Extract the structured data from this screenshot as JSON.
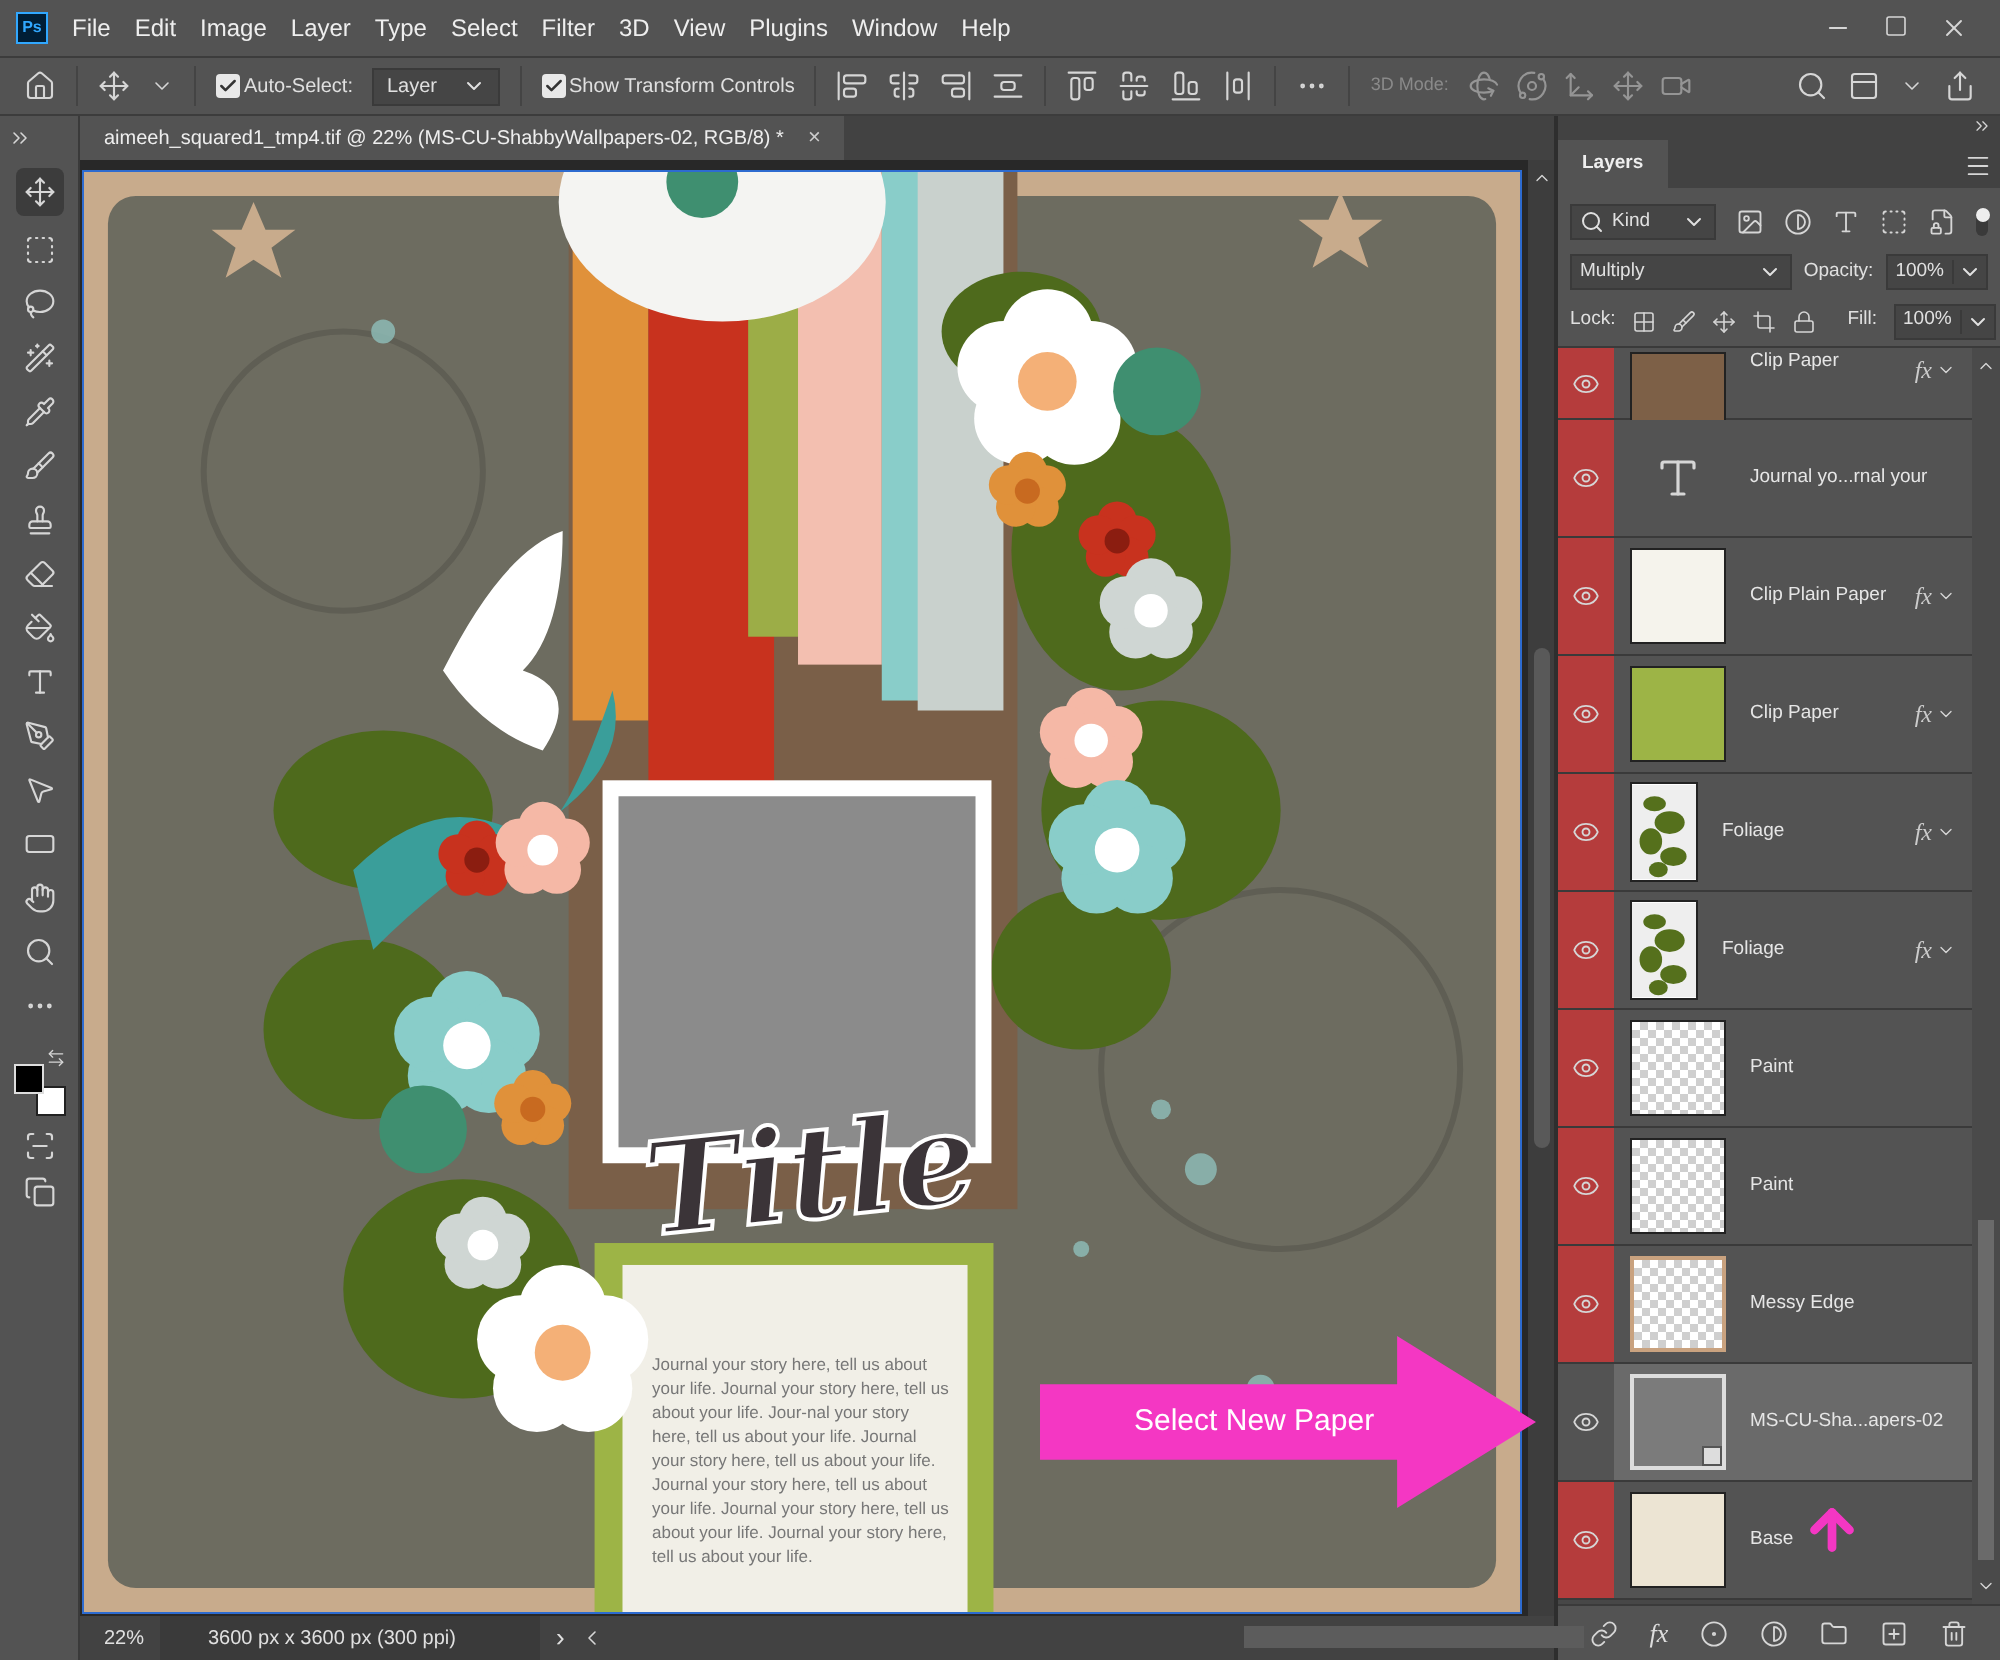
{
  "app_icon": "Ps",
  "menu": [
    "File",
    "Edit",
    "Image",
    "Layer",
    "Type",
    "Select",
    "Filter",
    "3D",
    "View",
    "Plugins",
    "Window",
    "Help"
  ],
  "options_bar": {
    "auto_select": {
      "label": "Auto-Select:",
      "checked": true
    },
    "target": "Layer",
    "show_transform": {
      "label": "Show Transform Controls",
      "checked": true
    },
    "mode_label": "3D Mode:"
  },
  "document_tab": {
    "title": "aimeeh_squared1_tmp4.tif @ 22% (MS-CU-ShabbyWallpapers-02, RGB/8) *",
    "close": "×"
  },
  "canvas": {
    "title": "Title",
    "journal": "Journal your story here, tell us about your life. Journal your story here, tell us about your life. Jour-nal your story here, tell us about your life. Journal your story here, tell us about your life. Journal your story here, tell us about your life. Journal your story here, tell us about your life. Journal your story here, tell us about your life.",
    "callout": "Select New Paper"
  },
  "status_bar": {
    "zoom": "22%",
    "size": "3600 px x 3600 px (300 ppi)",
    "more": "›"
  },
  "layers_panel": {
    "tab": "Layers",
    "filter": "Kind",
    "blend_mode": "Multiply",
    "opacity_label": "Opacity:",
    "opacity": "100%",
    "lock_label": "Lock:",
    "fill_label": "Fill:",
    "fill": "100%",
    "footer_fx": "fx",
    "layers": [
      {
        "name": "Clip Paper",
        "kind": "fill",
        "color": "#7d6047",
        "fx": "fx",
        "selected": false
      },
      {
        "name": "Journal yo...rnal your",
        "kind": "text",
        "selected": false
      },
      {
        "name": "Clip Plain Paper",
        "kind": "fill",
        "color": "#f5f3ec",
        "fx": "fx",
        "selected": false
      },
      {
        "name": "Clip Paper",
        "kind": "fill",
        "color": "#9db446",
        "fx": "fx",
        "selected": false
      },
      {
        "name": "Foliage",
        "kind": "foliage",
        "fx": "fx",
        "selected": false
      },
      {
        "name": "Foliage",
        "kind": "foliage",
        "fx": "fx",
        "selected": false
      },
      {
        "name": "Paint",
        "kind": "transparent",
        "selected": false
      },
      {
        "name": "Paint",
        "kind": "transparent",
        "selected": false
      },
      {
        "name": "Messy Edge",
        "kind": "edge",
        "selected": false
      },
      {
        "name": "MS-CU-Sha...apers-02",
        "kind": "smart",
        "selected": true
      },
      {
        "name": "Base",
        "kind": "fill",
        "color": "#ece4d3",
        "selected": false
      }
    ]
  }
}
